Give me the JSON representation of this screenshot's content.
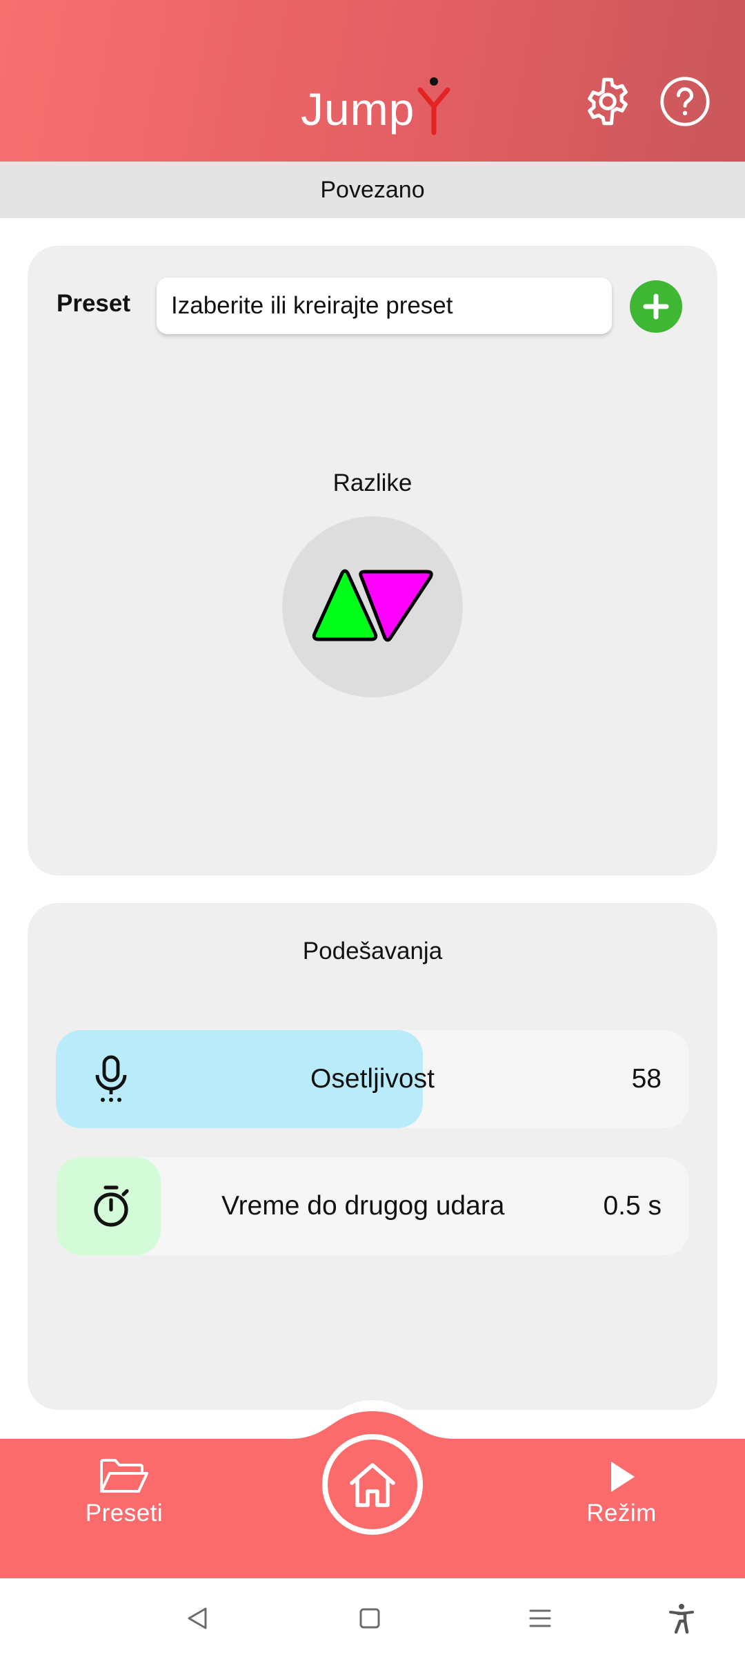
{
  "header": {
    "logo_text": "Jump",
    "icons": {
      "settings": "gear-icon",
      "help": "help-circle-icon"
    }
  },
  "status": {
    "text": "Povezano"
  },
  "preset_card": {
    "label": "Preset",
    "input_placeholder": "Izaberite ili kreirajte preset",
    "add_icon": "plus-icon",
    "mode_title": "Razlike",
    "mode_icon": "triangles-up-down-icon"
  },
  "settings_card": {
    "title": "Podešavanja",
    "sliders": [
      {
        "label": "Osetljivost",
        "value": "58",
        "icon": "microphone-icon",
        "fill_percent": 58
      },
      {
        "label": "Vreme do drugog udara",
        "value": "0.5 s",
        "icon": "stopwatch-icon"
      }
    ]
  },
  "bottom_nav": {
    "items": [
      {
        "label": "Preseti",
        "icon": "folder-open-icon"
      },
      {
        "label": "",
        "icon": "home-icon"
      },
      {
        "label": "Režim",
        "icon": "play-icon"
      }
    ]
  },
  "colors": {
    "header_start": "#f77070",
    "header_end": "#c9575b",
    "nav": "#fc6b6b",
    "add_button": "#3fb634",
    "slider_blue": "#b9ebfa",
    "slider_green": "#d4fbd7",
    "triangle_green": "#00ff1a",
    "triangle_magenta": "#ff00ff"
  }
}
